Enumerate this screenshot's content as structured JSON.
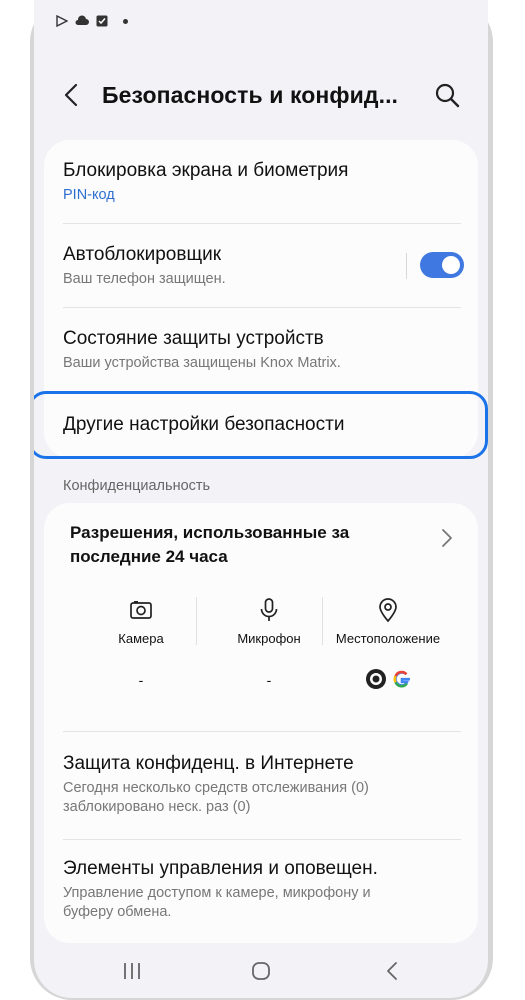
{
  "header": {
    "title": "Безопасность и конфид..."
  },
  "security_card": {
    "items": [
      {
        "title": "Блокировка экрана и биометрия",
        "subtitle": "PIN-код"
      },
      {
        "title": "Автоблокировщик",
        "subtitle": "Ваш телефон защищен.",
        "toggle_on": true
      },
      {
        "title": "Состояние защиты устройств",
        "subtitle": "Ваши устройства защищены Knox Matrix."
      },
      {
        "title": "Другие настройки безопасности"
      }
    ]
  },
  "privacy": {
    "section_label": "Конфиденциальность",
    "permissions": {
      "title": "Разрешения, использованные за последние 24 часа",
      "columns": [
        {
          "label": "Камера",
          "value": "-",
          "icon": "camera-icon"
        },
        {
          "label": "Микрофон",
          "value": "-",
          "icon": "microphone-icon"
        },
        {
          "label": "Местоположение",
          "value": "",
          "icon": "location-icon"
        }
      ]
    },
    "items": [
      {
        "title": "Защита конфиденц. в Интернете",
        "subtitle_line1": "Сегодня несколько средств отслеживания (0)",
        "subtitle_line2": "заблокировано неск. раз (0)"
      },
      {
        "title": "Элементы управления и оповещен.",
        "subtitle_line1": "Управление доступом к камере, микрофону и",
        "subtitle_line2": "буферу обмена."
      }
    ]
  },
  "colors": {
    "accent": "#3e78e0",
    "highlight": "#1a73e8",
    "link": "#2f6fd0"
  }
}
